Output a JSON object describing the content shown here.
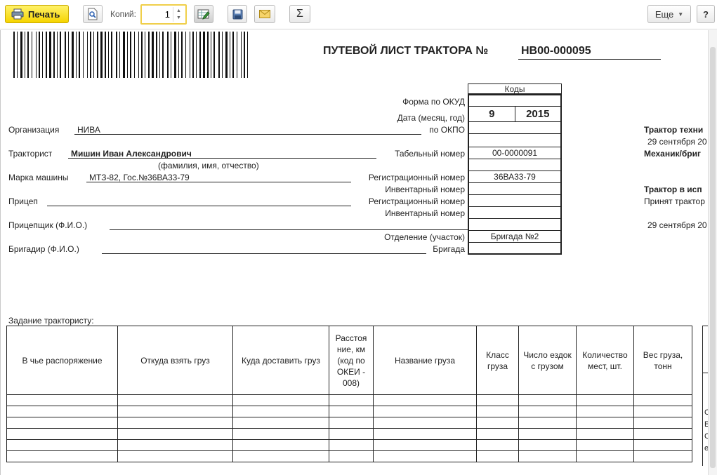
{
  "toolbar": {
    "print_label": "Печать",
    "copies_label": "Копий:",
    "copies_value": "1",
    "more_label": "Еще",
    "help_label": "?",
    "sum_label": "Σ"
  },
  "doc": {
    "title": "ПУТЕВОЙ ЛИСТ ТРАКТОРА №",
    "number": "НВ00-000095",
    "codes_header": "Коды",
    "okud_label": "Форма по ОКУД",
    "date_label": "Дата (месяц, год)",
    "month": "9",
    "year": "2015",
    "okpo_label": "по ОКПО",
    "tab_num_label": "Табельный номер",
    "tab_num_value": "00-0000091",
    "reg_num_label": "Регистрационный номер",
    "reg_num_value": "36ВА33-79",
    "inv_num_label": "Инвентарный номер",
    "reg_num2_label": "Регистрационный номер",
    "inv_num2_label": "Инвентарный номер",
    "division_label": "Отделение (участок)",
    "division_value": "Бригада №2",
    "brigade_label": "Бригада",
    "org_label": "Организация",
    "org_value": "НИВА",
    "driver_label": "Тракторист",
    "driver_value": "Мишин Иван Александрович",
    "driver_hint": "(фамилия, имя, отчество)",
    "machine_label": "Марка машины",
    "machine_value": "МТЗ-82, Гос.№36ВА33-79",
    "trailer_label": "Прицеп",
    "trailer_operator_label": "Прицепщик (Ф.И.О.)",
    "foreman_label": "Бригадир (Ф.И.О.)",
    "right_col": {
      "line1": "Трактор техни",
      "line2": "29 сентября 20",
      "line3": "Механик/бриг",
      "line4": "Трактор в исп",
      "line5": "Принят трактор",
      "line6": "29 сентября 20"
    },
    "task_label": "Задание трактористу:",
    "task_headers": [
      "В чье распоряжение",
      "Откуда взять груз",
      "Куда доставить груз",
      "Расстоя ние, км (код по ОКЕИ - 008)",
      "Название груза",
      "Класс груза",
      "Число ездок с грузом",
      "Количество мест, шт.",
      "Вес груза, тонн"
    ],
    "side_letters": [
      "С",
      "Е",
      "С",
      "е"
    ]
  }
}
